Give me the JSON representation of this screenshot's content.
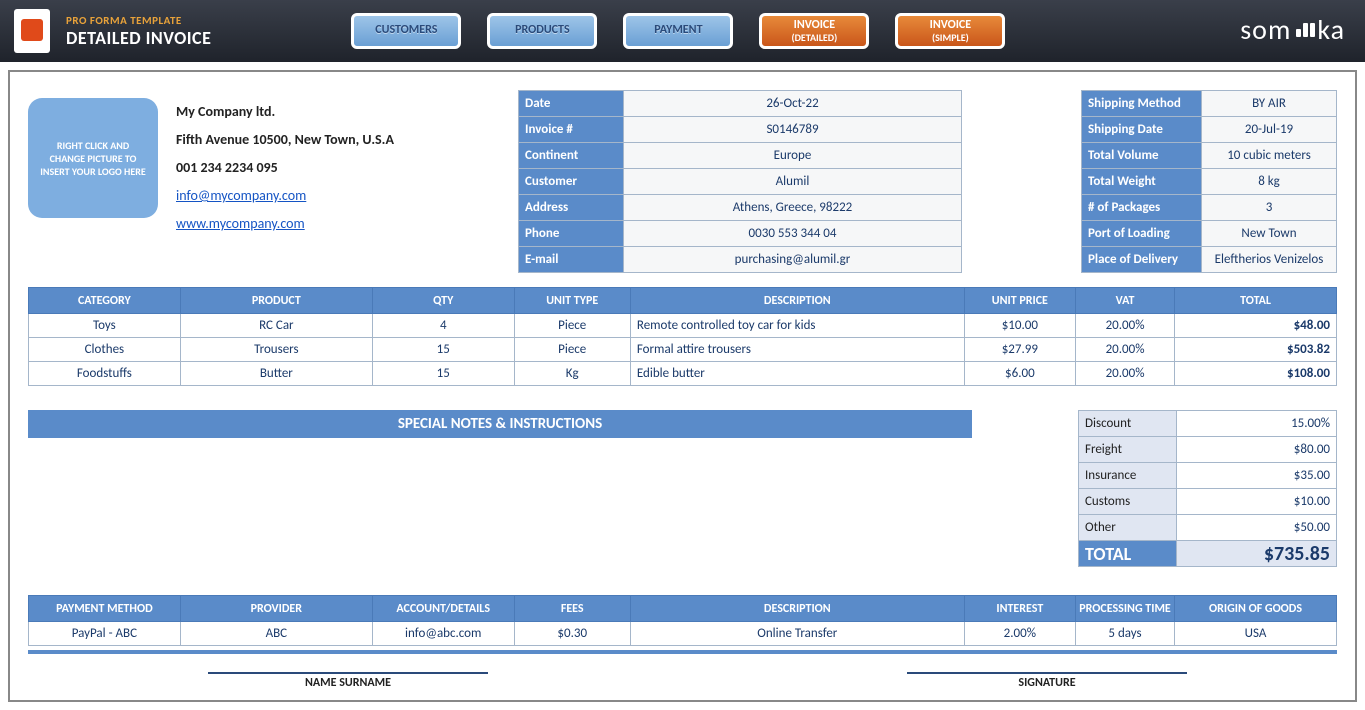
{
  "header": {
    "template_name": "PRO FORMA TEMPLATE",
    "page_title": "DETAILED INVOICE",
    "brand": "someka",
    "nav": {
      "customers": "CUSTOMERS",
      "products": "PRODUCTS",
      "payment": "PAYMENT",
      "invoice_detailed_line1": "INVOICE",
      "invoice_detailed_line2": "(DETAILED)",
      "invoice_simple_line1": "INVOICE",
      "invoice_simple_line2": "(SIMPLE)"
    }
  },
  "company": {
    "logo_placeholder": "RIGHT CLICK AND CHANGE PICTURE TO INSERT YOUR LOGO HERE",
    "name": "My Company ltd.",
    "address": "Fifth Avenue 10500, New Town, U.S.A",
    "phone": "001 234 2234 095",
    "email": "info@mycompany.com",
    "website": "www.mycompany.com"
  },
  "invoice_info": {
    "labels": {
      "date": "Date",
      "invoice_no": "Invoice #",
      "continent": "Continent",
      "customer": "Customer",
      "address": "Address",
      "phone": "Phone",
      "email": "E-mail"
    },
    "values": {
      "date": "26-Oct-22",
      "invoice_no": "S0146789",
      "continent": "Europe",
      "customer": "Alumil",
      "address": "Athens, Greece, 98222",
      "phone": "0030 553 344 04",
      "email": "purchasing@alumil.gr"
    }
  },
  "shipping": {
    "labels": {
      "method": "Shipping Method",
      "date": "Shipping Date",
      "volume": "Total Volume",
      "weight": "Total Weight",
      "packages": "# of Packages",
      "port": "Port of Loading",
      "delivery": "Place of Delivery"
    },
    "values": {
      "method": "BY AIR",
      "date": "20-Jul-19",
      "volume": "10 cubic meters",
      "weight": "8 kg",
      "packages": "3",
      "port": "New Town",
      "delivery": "Eleftherios Venizelos"
    }
  },
  "items": {
    "headers": {
      "category": "CATEGORY",
      "product": "PRODUCT",
      "qty": "QTY",
      "unit": "UNIT TYPE",
      "desc": "DESCRIPTION",
      "price": "UNIT PRICE",
      "vat": "VAT",
      "total": "TOTAL"
    },
    "rows": [
      {
        "category": "Toys",
        "product": "RC Car",
        "qty": "4",
        "unit": "Piece",
        "desc": "Remote controlled toy car for kids",
        "price": "$10.00",
        "vat": "20.00%",
        "total": "$48.00"
      },
      {
        "category": "Clothes",
        "product": "Trousers",
        "qty": "15",
        "unit": "Piece",
        "desc": "Formal attire trousers",
        "price": "$27.99",
        "vat": "20.00%",
        "total": "$503.82"
      },
      {
        "category": "Foodstuffs",
        "product": "Butter",
        "qty": "15",
        "unit": "Kg",
        "desc": "Edible butter",
        "price": "$6.00",
        "vat": "20.00%",
        "total": "$108.00"
      }
    ]
  },
  "notes": {
    "header": "SPECIAL NOTES & INSTRUCTIONS"
  },
  "totals": {
    "rows": [
      {
        "label": "Discount",
        "value": "15.00%"
      },
      {
        "label": "Freight",
        "value": "$80.00"
      },
      {
        "label": "Insurance",
        "value": "$35.00"
      },
      {
        "label": "Customs",
        "value": "$10.00"
      },
      {
        "label": "Other",
        "value": "$50.00"
      }
    ],
    "grand": {
      "label": "TOTAL",
      "value": "$735.85"
    }
  },
  "payment": {
    "headers": {
      "method": "PAYMENT METHOD",
      "provider": "PROVIDER",
      "account": "ACCOUNT/DETAILS",
      "fees": "FEES",
      "desc": "DESCRIPTION",
      "interest": "INTEREST",
      "time": "PROCESSING TIME",
      "origin": "ORIGIN OF GOODS"
    },
    "row": {
      "method": "PayPal - ABC",
      "provider": "ABC",
      "account": "info@abc.com",
      "fees": "$0.30",
      "desc": "Online Transfer",
      "interest": "2.00%",
      "time": "5 days",
      "origin": "USA"
    }
  },
  "signatures": {
    "name": "NAME SURNAME",
    "sig": "SIGNATURE"
  }
}
